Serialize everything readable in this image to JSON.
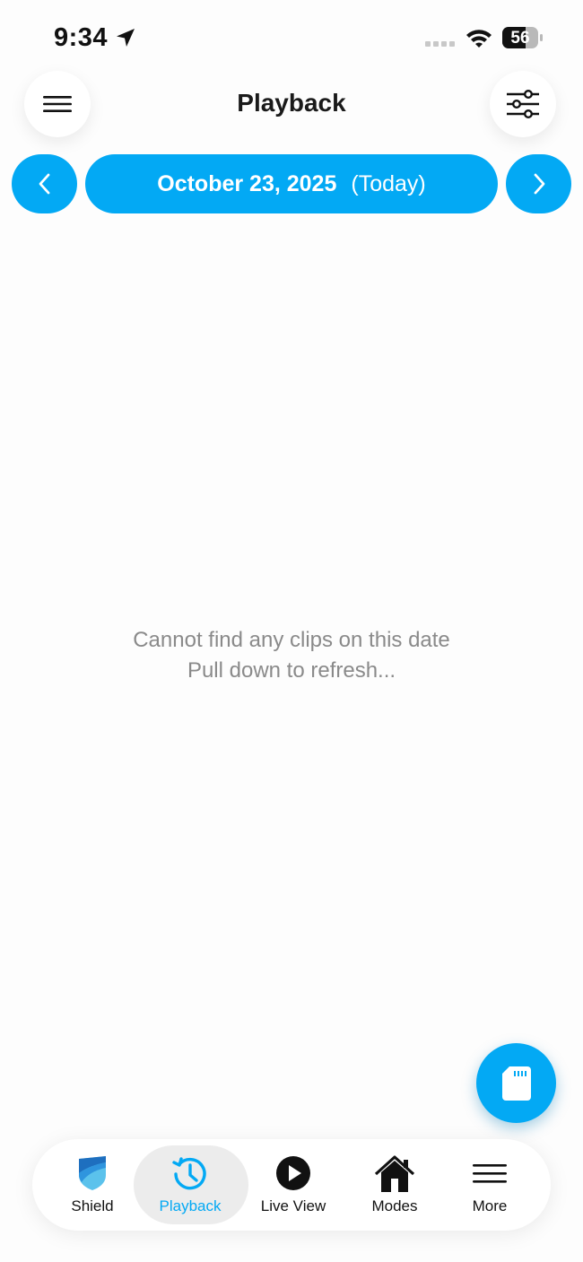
{
  "status": {
    "time": "9:34",
    "battery": "56"
  },
  "header": {
    "title": "Playback"
  },
  "date_nav": {
    "date": "October 23, 2025",
    "relative": "(Today)"
  },
  "empty_state": {
    "line1": "Cannot find any clips on this date",
    "line2": "Pull down to refresh..."
  },
  "bottom_nav": {
    "items": [
      {
        "label": "Shield",
        "icon": "shield-icon"
      },
      {
        "label": "Playback",
        "icon": "history-icon",
        "active": true
      },
      {
        "label": "Live View",
        "icon": "play-circle-icon"
      },
      {
        "label": "Modes",
        "icon": "home-icon"
      },
      {
        "label": "More",
        "icon": "menu-icon"
      }
    ]
  },
  "colors": {
    "accent": "#03a9f4",
    "text_muted": "#8a8a8a"
  }
}
